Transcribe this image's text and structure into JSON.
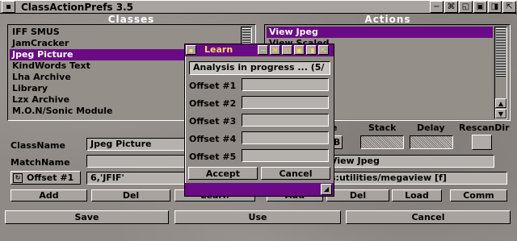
{
  "window": {
    "title": "ClassActionPrefs 3.5"
  },
  "classes": {
    "group_label": "Classes",
    "items": [
      "IFF SMUS",
      "JamCracker",
      "Jpeg Picture",
      "KindWords Text",
      "Lha Archive",
      "Library",
      "Lzx Archive",
      "M.O.N/Sonic Module"
    ],
    "selected_index": 2
  },
  "actions": {
    "group_label": "Actions",
    "items": [
      "View Jpeg",
      "View Scaled"
    ],
    "selected_index": 0
  },
  "form": {
    "classname_label": "ClassName",
    "classname_value": "Jpeg Picture",
    "matchname_label": "MatchName",
    "matchname_value": "",
    "offset_cycle_label": "Offset #1",
    "offset_value": "6,'JFIF'",
    "add_label": "Add",
    "del_label": "Del",
    "learn_label": "Learn"
  },
  "action_form": {
    "stack_label": "Stack",
    "delay_label": "Delay",
    "rescandir_label": "RescanDir",
    "partial_e_label": "e",
    "wb_label": "WB",
    "action_name_value": "View Jpeg",
    "command_value": "s:utilities/megaview [f]",
    "add_label": "Add",
    "del_label": "Del",
    "load_label": "Load",
    "comm_label": "Comm"
  },
  "bottom": {
    "save_label": "Save",
    "use_label": "Use",
    "cancel_label": "Cancel"
  },
  "learn_window": {
    "title": "Learn",
    "status_value": "Analysis in progress ... (5/",
    "offsets": [
      {
        "label": "Offset #1",
        "value": ""
      },
      {
        "label": "Offset #2",
        "value": ""
      },
      {
        "label": "Offset #3",
        "value": ""
      },
      {
        "label": "Offset #4",
        "value": ""
      },
      {
        "label": "Offset #5",
        "value": ""
      }
    ],
    "accept_label": "Accept",
    "cancel_label": "Cancel"
  },
  "colors": {
    "selection": "#6b0a86",
    "learn_title_text": "#ffd86a",
    "group_label": "#ffffff"
  },
  "icons": [
    "close-icon",
    "depth-icon",
    "zoom-icon",
    "iconify-icon",
    "cycle-icon",
    "arrow-up-icon",
    "arrow-down-icon",
    "resize-icon"
  ]
}
